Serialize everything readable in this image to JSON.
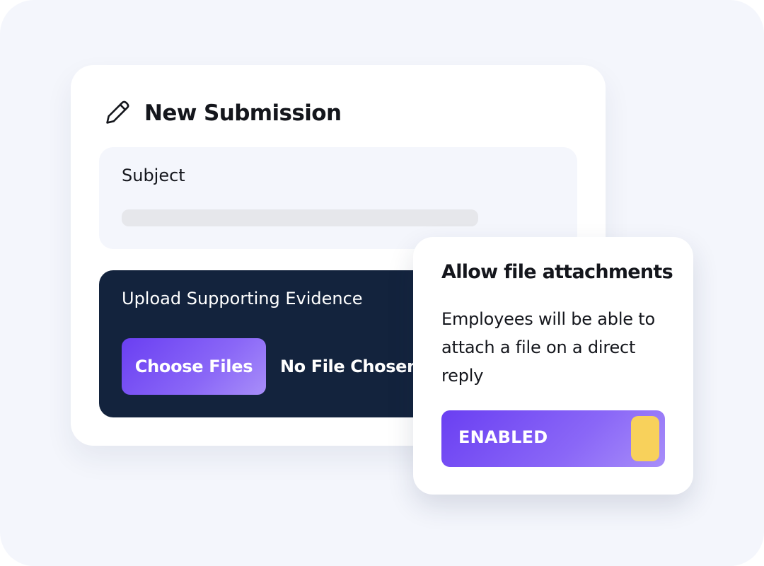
{
  "colors": {
    "background": "#f4f6fc",
    "card": "#ffffff",
    "upload_panel": "#13233d",
    "accent_start": "#6a3ff2",
    "accent_end": "#a88ef9",
    "toggle_knob": "#f8d15b",
    "input_bar": "#e6e7eb"
  },
  "submission": {
    "icon": "pencil-icon",
    "title": "New Submission",
    "subject_label": "Subject",
    "subject_value": "",
    "upload_label": "Upload Supporting Evidence",
    "choose_files_label": "Choose Files",
    "file_status": "No File Chosen"
  },
  "attachments": {
    "title": "Allow file attachments",
    "description": "Employees will be able to attach a file on a direct reply",
    "toggle_label": "ENABLED",
    "toggle_on": true
  }
}
